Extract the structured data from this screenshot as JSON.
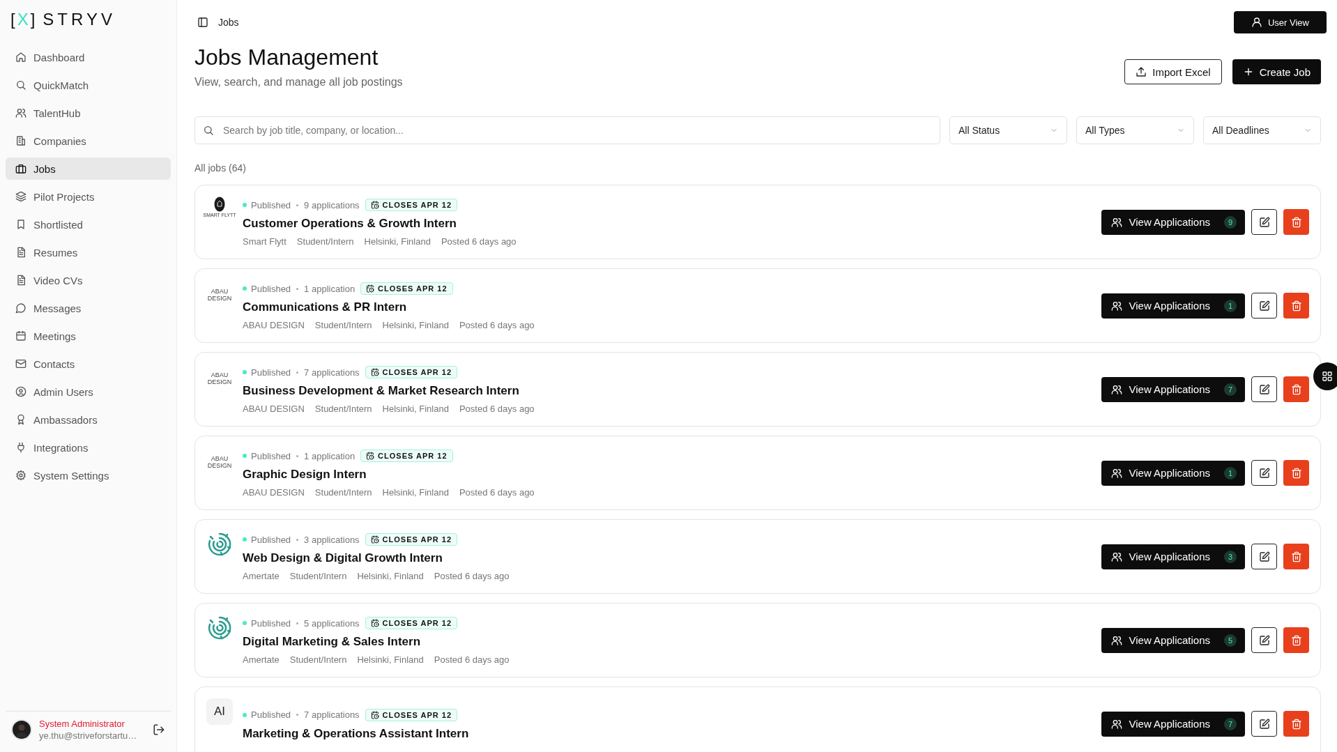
{
  "logo": {
    "open": "[",
    "mark": "X",
    "close": "]",
    "name": "STRYV"
  },
  "sidebar": {
    "items": [
      {
        "label": "Dashboard",
        "selected": false
      },
      {
        "label": "QuickMatch",
        "selected": false
      },
      {
        "label": "TalentHub",
        "selected": false
      },
      {
        "label": "Companies",
        "selected": false
      },
      {
        "label": "Jobs",
        "selected": true
      },
      {
        "label": "Pilot Projects",
        "selected": false
      },
      {
        "label": "Shortlisted",
        "selected": false
      },
      {
        "label": "Resumes",
        "selected": false
      },
      {
        "label": "Video CVs",
        "selected": false
      },
      {
        "label": "Messages",
        "selected": false
      },
      {
        "label": "Meetings",
        "selected": false
      },
      {
        "label": "Contacts",
        "selected": false
      },
      {
        "label": "Admin Users",
        "selected": false
      },
      {
        "label": "Ambassadors",
        "selected": false
      },
      {
        "label": "Integrations",
        "selected": false
      },
      {
        "label": "System Settings",
        "selected": false
      }
    ],
    "user": {
      "name": "System Administrator",
      "email": "ye.thu@striveforstartu…"
    }
  },
  "topbar": {
    "breadcrumb": "Jobs",
    "user_view_button": "User View"
  },
  "header": {
    "title": "Jobs Management",
    "subtitle": "View, search, and manage all job postings",
    "import_button": "Import Excel",
    "create_button": "Create Job"
  },
  "filters": {
    "search": {
      "placeholder": "Search by job title, company, or location..."
    },
    "selects": [
      "All Status",
      "All Types",
      "All Deadlines"
    ]
  },
  "jobs_count": "All jobs (64)",
  "jobs": [
    {
      "logo": {
        "kind": "emblem",
        "text": "SMART FLYTT"
      },
      "status": "Published",
      "applications": "9 applications",
      "deadline": "CLOSES APR 12",
      "title": "Customer Operations & Growth Intern",
      "meta": [
        "Smart Flytt",
        "Student/Intern",
        "Helsinki, Finland",
        "Posted 6 days ago"
      ],
      "action": "View Applications",
      "count": "9"
    },
    {
      "logo": {
        "kind": "wordmark",
        "text": "ABAU DESIGN"
      },
      "status": "Published",
      "applications": "1 application",
      "deadline": "CLOSES APR 12",
      "title": "Communications & PR Intern",
      "meta": [
        "ABAU DESIGN",
        "Student/Intern",
        "Helsinki, Finland",
        "Posted 6 days ago"
      ],
      "action": "View Applications",
      "count": "1"
    },
    {
      "logo": {
        "kind": "wordmark",
        "text": "ABAU DESIGN"
      },
      "status": "Published",
      "applications": "7 applications",
      "deadline": "CLOSES APR 12",
      "title": "Business Development & Market Research Intern",
      "meta": [
        "ABAU DESIGN",
        "Student/Intern",
        "Helsinki, Finland",
        "Posted 6 days ago"
      ],
      "action": "View Applications",
      "count": "7"
    },
    {
      "logo": {
        "kind": "wordmark",
        "text": "ABAU DESIGN"
      },
      "status": "Published",
      "applications": "1 application",
      "deadline": "CLOSES APR 12",
      "title": "Graphic Design Intern",
      "meta": [
        "ABAU DESIGN",
        "Student/Intern",
        "Helsinki, Finland",
        "Posted 6 days ago"
      ],
      "action": "View Applications",
      "count": "1"
    },
    {
      "logo": {
        "kind": "swirl"
      },
      "status": "Published",
      "applications": "3 applications",
      "deadline": "CLOSES APR 12",
      "title": "Web Design & Digital Growth Intern",
      "meta": [
        "Amertate",
        "Student/Intern",
        "Helsinki, Finland",
        "Posted 6 days ago"
      ],
      "action": "View Applications",
      "count": "3"
    },
    {
      "logo": {
        "kind": "swirl"
      },
      "status": "Published",
      "applications": "5 applications",
      "deadline": "CLOSES APR 12",
      "title": "Digital Marketing & Sales Intern",
      "meta": [
        "Amertate",
        "Student/Intern",
        "Helsinki, Finland",
        "Posted 6 days ago"
      ],
      "action": "View Applications",
      "count": "5"
    },
    {
      "logo": {
        "kind": "initials",
        "text": "AI"
      },
      "status": "Published",
      "applications": "7 applications",
      "deadline": "CLOSES APR 12",
      "title": "Marketing & Operations Assistant Intern",
      "action": "View Applications",
      "count": "7"
    }
  ]
}
